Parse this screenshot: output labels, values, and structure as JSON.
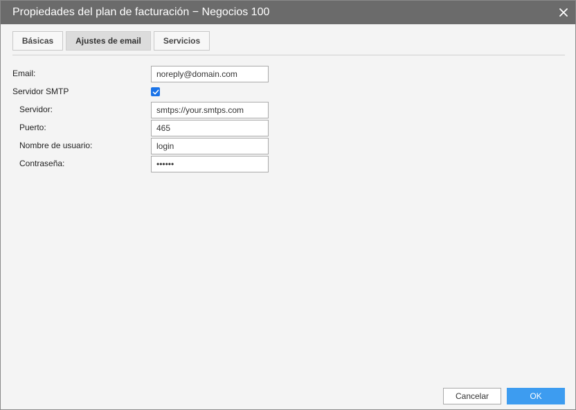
{
  "dialog": {
    "title": "Propiedades del plan de facturación − Negocios 100",
    "close_icon": "close-icon"
  },
  "tabs": [
    {
      "label": "Básicas",
      "active": false
    },
    {
      "label": "Ajustes de email",
      "active": true
    },
    {
      "label": "Servicios",
      "active": false
    }
  ],
  "form": {
    "email": {
      "label": "Email:",
      "value": "noreply@domain.com"
    },
    "smtp": {
      "label": "Servidor SMTP",
      "checked": true
    },
    "server": {
      "label": "Servidor:",
      "value": "smtps://your.smtps.com"
    },
    "port": {
      "label": "Puerto:",
      "value": "465"
    },
    "username": {
      "label": "Nombre de usuario:",
      "value": "login"
    },
    "password": {
      "label": "Contraseña:",
      "value": "••••••"
    }
  },
  "buttons": {
    "cancel": "Cancelar",
    "ok": "OK"
  },
  "colors": {
    "titlebar": "#6b6b6b",
    "accent": "#3d9cf0",
    "checkbox": "#1a73e8",
    "background": "#f4f4f4"
  }
}
